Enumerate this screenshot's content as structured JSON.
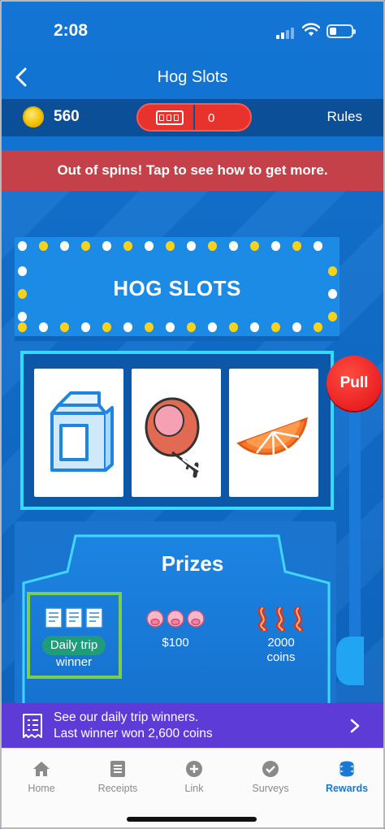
{
  "status_bar": {
    "time": "2:08"
  },
  "nav": {
    "title": "Hog Slots"
  },
  "header": {
    "coins": "560",
    "spins": "0",
    "rules_label": "Rules"
  },
  "out_of_spins_banner": "Out of spins! Tap to see how to get more.",
  "machine": {
    "title": "HOG SLOTS",
    "reels": [
      "milk-carton-icon",
      "ham-icon",
      "orange-slice-icon"
    ],
    "pull_label": "Pull"
  },
  "prizes": {
    "title": "Prizes",
    "items": [
      {
        "label_line1": "Daily trip",
        "label_line2": "winner",
        "icon": "receipt-icon",
        "selected": true
      },
      {
        "label_line1": "$100",
        "label_line2": "",
        "icon": "pig-icon"
      },
      {
        "label_line1": "2000",
        "label_line2": "coins",
        "icon": "bacon-icon"
      }
    ]
  },
  "promo": {
    "line1": "See our daily trip winners.",
    "line2": "Last winner won 2,600 coins"
  },
  "tabs": [
    {
      "label": "Home",
      "icon": "home-icon"
    },
    {
      "label": "Receipts",
      "icon": "receipts-icon"
    },
    {
      "label": "Link",
      "icon": "link-plus-icon"
    },
    {
      "label": "Surveys",
      "icon": "surveys-check-icon"
    },
    {
      "label": "Rewards",
      "icon": "rewards-coins-icon",
      "active": true
    }
  ],
  "colors": {
    "background": "#1375d4",
    "banner_red": "#c5414a",
    "pull_red": "#e00f16",
    "promo_purple": "#5c3bd7",
    "active_tab": "#1a77d2",
    "selected_prize": "#7ccf4a"
  }
}
